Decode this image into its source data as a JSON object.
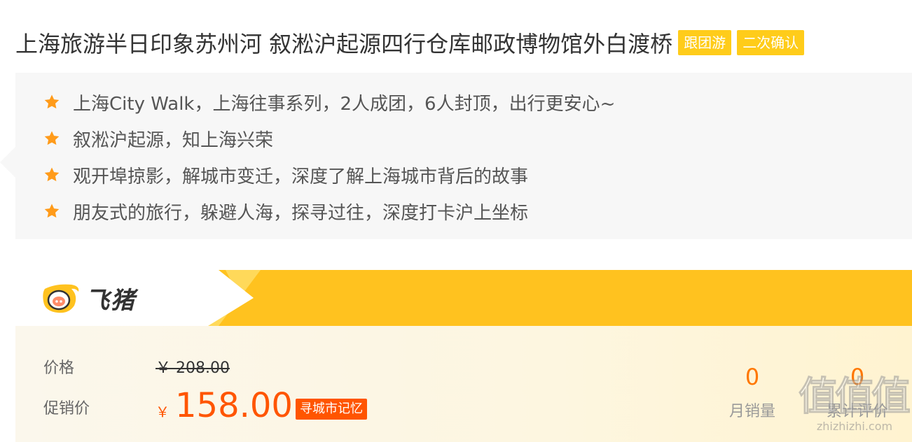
{
  "title": "上海旅游半日印象苏州河 叙淞沪起源四行仓库邮政博物馆外白渡桥",
  "tags": [
    "跟团游",
    "二次确认"
  ],
  "highlights": [
    "上海City Walk，上海往事系列，2人成团，6人封顶，出行更安心~",
    "叙淞沪起源，知上海兴荣",
    "观开埠掠影，解城市变迁，深度了解上海城市背后的故事",
    "朋友式的旅行，躲避人海，探寻过往，深度打卡沪上坐标"
  ],
  "brand": {
    "logo_text": "飞猪"
  },
  "pricing": {
    "price_label": "价格",
    "original_price": "￥ 208.00",
    "promo_label": "促销价",
    "currency": "￥",
    "promo_price": "158.00",
    "promo_tag": "寻城市记忆"
  },
  "stats": {
    "monthly_sales_value": "0",
    "monthly_sales_label": "月销量",
    "reviews_value": "0",
    "reviews_label": "累计评价"
  },
  "watermark": {
    "logo_text": "值值值",
    "site": "zhizhizhi.com"
  },
  "colors": {
    "accent": "#ff5500",
    "brand_yellow": "#ffc21f",
    "tag_yellow": "#ffcc1a",
    "star": "#ff9b1a"
  }
}
